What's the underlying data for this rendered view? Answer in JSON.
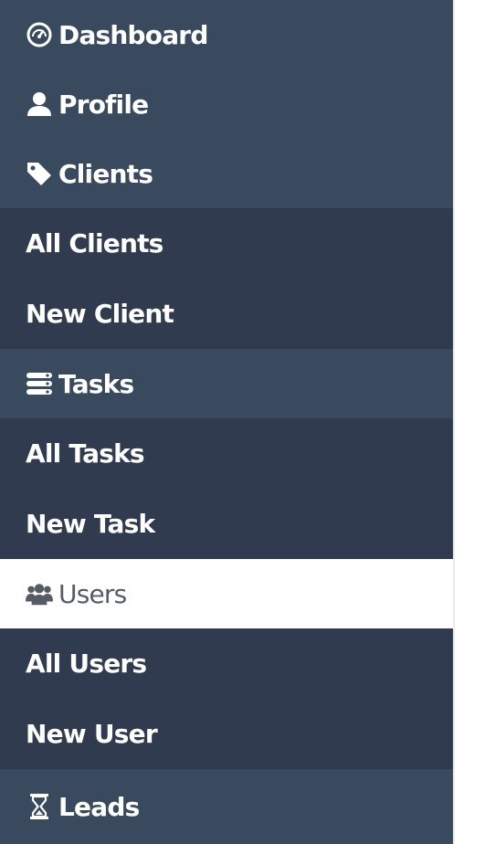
{
  "sidebar": {
    "items": [
      {
        "label": "Dashboard",
        "icon": "dashboard-gauge-icon"
      },
      {
        "label": "Profile",
        "icon": "user-icon"
      },
      {
        "label": "Clients",
        "icon": "tag-icon"
      },
      {
        "label": "All Clients"
      },
      {
        "label": "New Client"
      },
      {
        "label": "Tasks",
        "icon": "tasks-stack-icon"
      },
      {
        "label": "All Tasks"
      },
      {
        "label": "New Task"
      },
      {
        "label": "Users",
        "icon": "users-group-icon"
      },
      {
        "label": "All Users"
      },
      {
        "label": "New User"
      },
      {
        "label": "Leads",
        "icon": "hourglass-icon"
      }
    ]
  },
  "colors": {
    "sidebar_background": "#3a4a5e",
    "submenu_background": "#303b4f",
    "active_background": "#ffffff",
    "active_text": "#555c66",
    "text": "#ffffff"
  }
}
